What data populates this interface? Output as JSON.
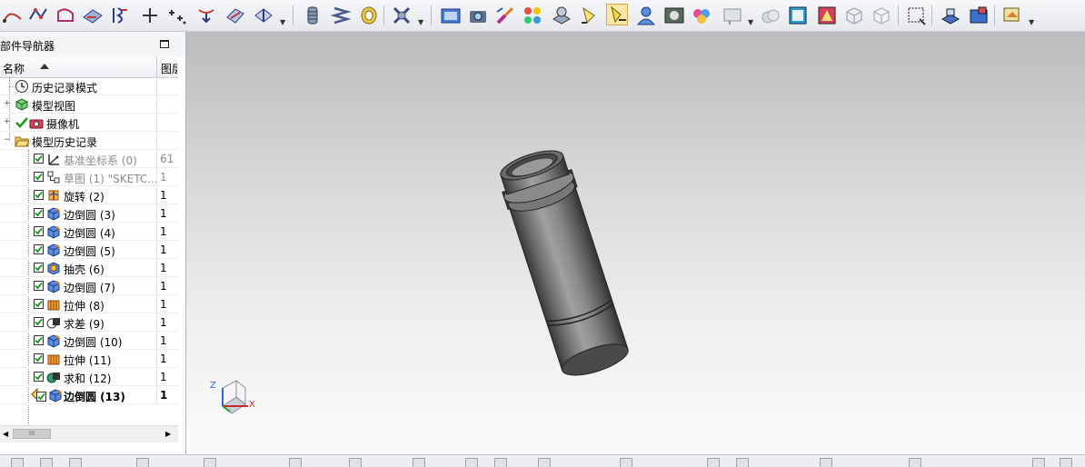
{
  "navigator": {
    "title": "部件导航器",
    "columns": {
      "name": "名称",
      "layer": "图层"
    },
    "rows": [
      {
        "label": "历史记录模式",
        "num": ""
      },
      {
        "label": "模型视图",
        "num": ""
      },
      {
        "label": "摄像机",
        "num": ""
      },
      {
        "label": "模型历史记录",
        "num": ""
      },
      {
        "label": "基准坐标系 (0)",
        "num": "61"
      },
      {
        "label": "草图 (1) \"SKETC...",
        "num": "1"
      },
      {
        "label": "旋转 (2)",
        "num": "1"
      },
      {
        "label": "边倒圆 (3)",
        "num": "1"
      },
      {
        "label": "边倒圆 (4)",
        "num": "1"
      },
      {
        "label": "边倒圆 (5)",
        "num": "1"
      },
      {
        "label": "抽壳 (6)",
        "num": "1"
      },
      {
        "label": "边倒圆 (7)",
        "num": "1"
      },
      {
        "label": "拉伸 (8)",
        "num": "1"
      },
      {
        "label": "求差 (9)",
        "num": "1"
      },
      {
        "label": "边倒圆 (10)",
        "num": "1"
      },
      {
        "label": "拉伸 (11)",
        "num": "1"
      },
      {
        "label": "求和 (12)",
        "num": "1"
      },
      {
        "label": "边倒圆 (13)",
        "num": "1"
      }
    ],
    "scroll_thumb": "III"
  },
  "triad": {
    "z": "Z",
    "x": "X"
  },
  "colors": {
    "selected_bg": "#fbe7a6",
    "checkbox_green": "#1a9a1a",
    "viewport_top": "#b9bbbd",
    "viewport_bottom": "#fbfbfb"
  },
  "toolbar_icons": [
    "arc-icon",
    "spline-icon",
    "sketch-curve-icon",
    "plane-icon",
    "offset-curve-icon",
    "point-icon",
    "point-set-icon",
    "project-curve-icon",
    "datum-plane-icon",
    "datum-axis-icon",
    "cylinder-tool-icon",
    "spring-icon",
    "coin-icon",
    "fastener-icon",
    "render-view-icon",
    "camera-icon",
    "paint-brush-icon",
    "color-balls-icon",
    "material-icon",
    "light-icon",
    "spotlight-icon",
    "user-icon",
    "scene-icon",
    "palette-icon",
    "display-style-icon",
    "fog-icon",
    "cube-shade-icon",
    "face-color-icon",
    "wireframe-cube-icon",
    "hidden-cube-icon",
    "zoom-window-icon",
    "view-orient-icon",
    "view-named-icon",
    "export-view-icon"
  ]
}
